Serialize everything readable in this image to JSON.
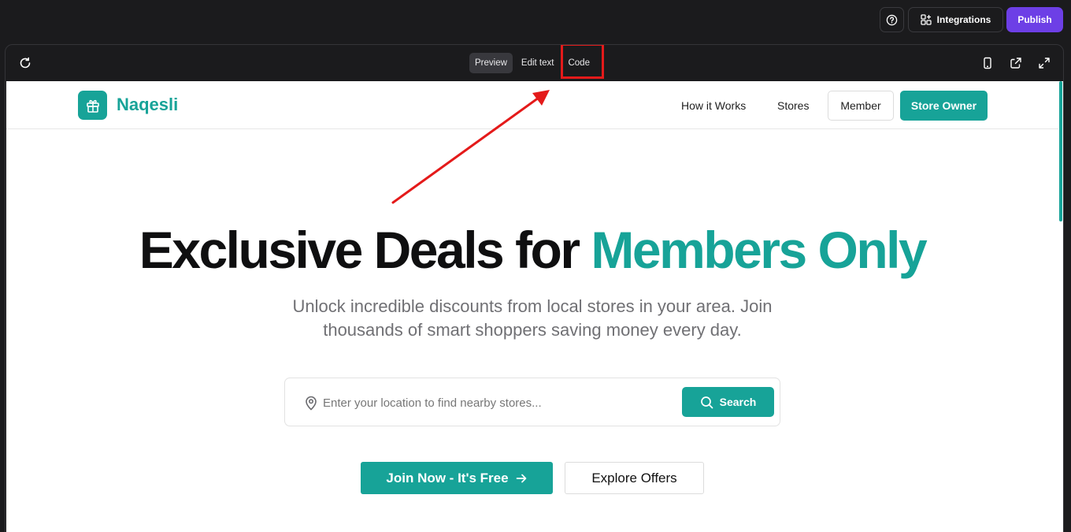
{
  "topbar": {
    "integrations_label": "Integrations",
    "publish_label": "Publish"
  },
  "preview_toolbar": {
    "tabs": [
      {
        "label": "Preview",
        "active": true
      },
      {
        "label": "Edit text",
        "active": false
      },
      {
        "label": "Code",
        "active": false
      }
    ]
  },
  "site": {
    "logo_text": "Naqesli",
    "nav": {
      "how_it_works": "How it Works",
      "stores": "Stores",
      "member": "Member",
      "store_owner": "Store Owner"
    },
    "hero": {
      "title_main": "Exclusive Deals for ",
      "title_accent": "Members Only",
      "subtitle_line1": "Unlock incredible discounts from local stores in your area. Join",
      "subtitle_line2": "thousands of smart shoppers saving money every day."
    },
    "search": {
      "placeholder": "Enter your location to find nearby stores...",
      "value": "",
      "button_label": "Search"
    },
    "cta": {
      "join_label": "Join Now - It's Free",
      "explore_label": "Explore Offers"
    }
  },
  "colors": {
    "brand": "#17a398",
    "publish": "#6d3fe6",
    "annotation": "#e41a1a"
  },
  "icons": [
    "help-icon",
    "integrations-icon",
    "refresh-icon",
    "mobile-icon",
    "external-link-icon",
    "fullscreen-icon",
    "gift-icon",
    "map-pin-icon",
    "search-icon",
    "arrow-right-icon"
  ]
}
